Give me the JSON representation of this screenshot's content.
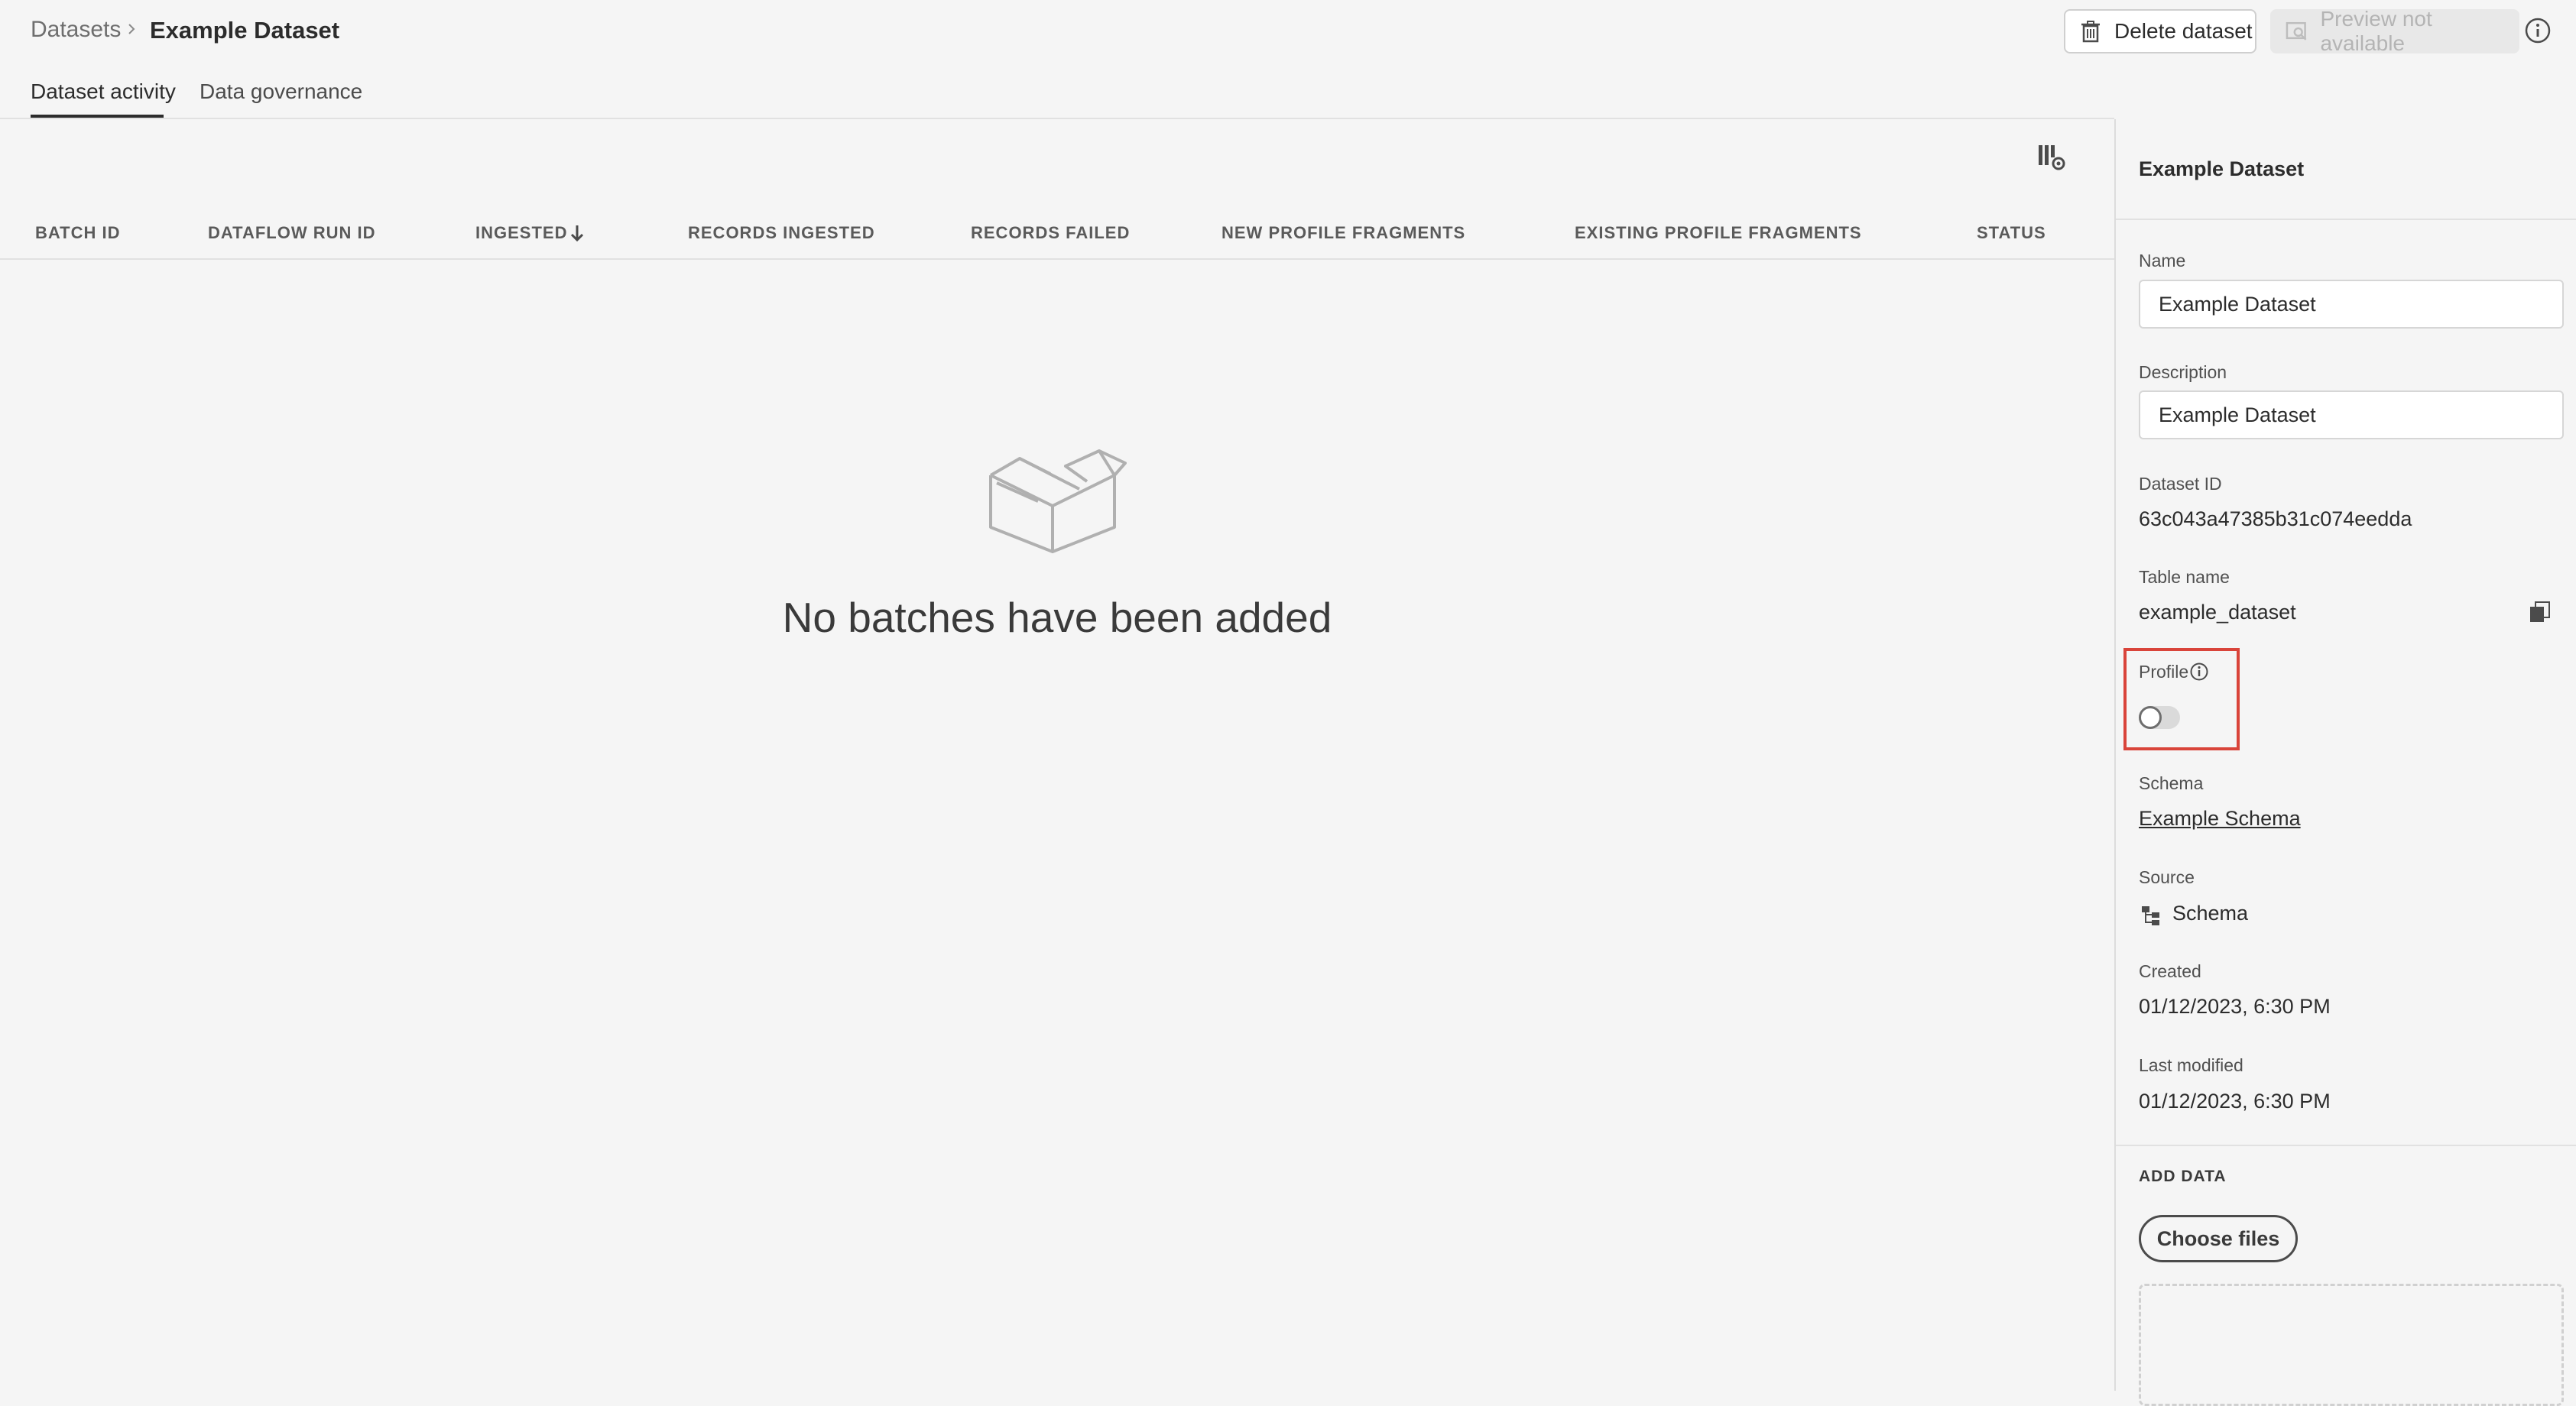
{
  "breadcrumb": {
    "parent": "Datasets",
    "current": "Example Dataset"
  },
  "header": {
    "delete_label": "Delete dataset",
    "preview_label": "Preview not available",
    "icons": {
      "delete": "trash-icon",
      "preview": "preview-icon",
      "info": "info-icon",
      "separator": "chevron-right-icon"
    }
  },
  "tabs": [
    {
      "label": "Dataset activity",
      "active": true
    },
    {
      "label": "Data governance",
      "active": false
    }
  ],
  "table": {
    "columns": [
      "BATCH ID",
      "DATAFLOW RUN ID",
      "INGESTED",
      "RECORDS INGESTED",
      "RECORDS FAILED",
      "NEW PROFILE FRAGMENTS",
      "EXISTING PROFILE FRAGMENTS",
      "STATUS"
    ],
    "sort_column": "INGESTED",
    "sort_direction": "descending",
    "empty_message": "No batches have been added"
  },
  "details": {
    "title": "Example Dataset",
    "name_label": "Name",
    "name_value": "Example Dataset",
    "description_label": "Description",
    "description_value": "Example Dataset",
    "dataset_id_label": "Dataset ID",
    "dataset_id_value": "63c043a47385b31c074eedda",
    "table_name_label": "Table name",
    "table_name_value": "example_dataset",
    "profile_label": "Profile",
    "profile_enabled": false,
    "schema_label": "Schema",
    "schema_value": "Example Schema",
    "source_label": "Source",
    "source_value": "Schema",
    "created_label": "Created",
    "created_value": "01/12/2023, 6:30 PM",
    "modified_label": "Last modified",
    "modified_value": "01/12/2023, 6:30 PM",
    "add_data_label": "ADD DATA",
    "choose_files_label": "Choose files"
  },
  "colors": {
    "highlight": "#d9443a",
    "background": "#f5f5f5"
  }
}
